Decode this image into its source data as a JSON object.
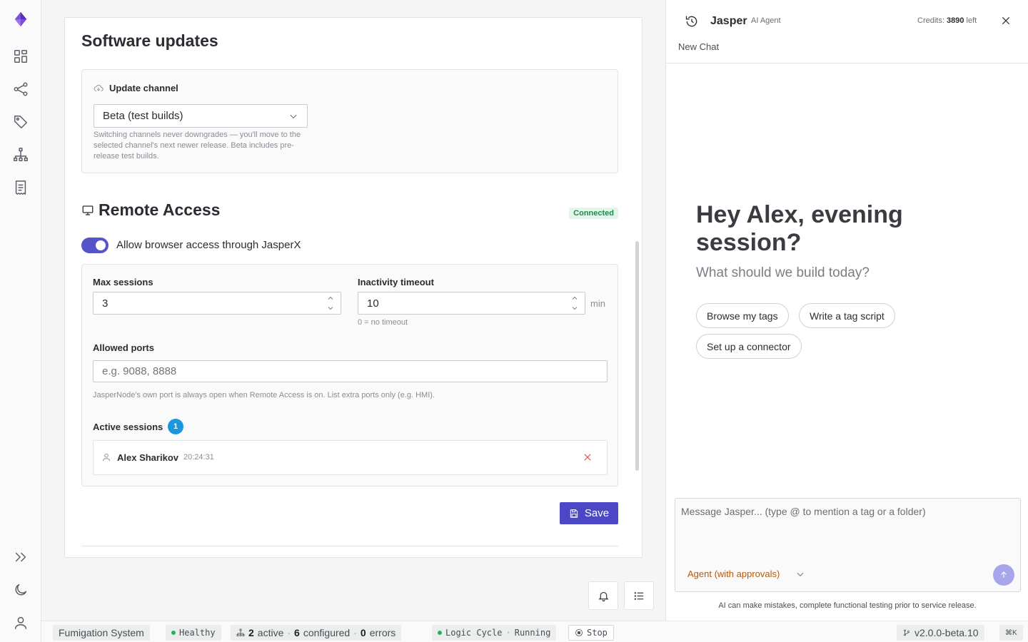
{
  "rail": {
    "items": [
      "logo-icon",
      "dashboard-icon",
      "connections-icon",
      "tags-icon",
      "hierarchy-icon",
      "receipt-icon",
      "expand-icon",
      "moon-icon",
      "user-icon"
    ]
  },
  "updates": {
    "title": "Software updates",
    "channel_label": "Update channel",
    "channel_value": "Beta (test builds)",
    "channel_help": "Switching channels never downgrades — you'll move to the selected channel's next newer release. Beta includes pre-release test builds."
  },
  "remote": {
    "title": "Remote Access",
    "status_badge": "Connected",
    "status_color": "#1f8a4c",
    "toggle_label": "Allow browser access through JasperX",
    "toggle_on": true,
    "max_sessions_label": "Max sessions",
    "max_sessions_value": "3",
    "inactivity_label": "Inactivity timeout",
    "inactivity_value": "10",
    "inactivity_unit": "min",
    "inactivity_hint": "0 = no timeout",
    "ports_label": "Allowed ports",
    "ports_placeholder": "e.g. 9088, 8888",
    "ports_hint": "JasperNode's own port is always open when Remote Access is on. List extra ports only (e.g. HMI).",
    "active_label": "Active sessions",
    "active_count": "1",
    "sessions": [
      {
        "name": "Alex Sharikov",
        "time": "20:24:31"
      }
    ],
    "save_label": "Save",
    "accent": "#4c48c5"
  },
  "status": {
    "system": "Fumigation System",
    "health": "Healthy",
    "active_count": "2",
    "active_word": "active",
    "configured_count": "6",
    "configured_word": "configured",
    "errors_count": "0",
    "errors_word": "errors",
    "logic_label": "Logic Cycle",
    "logic_state": "Running",
    "stop_label": "Stop",
    "version": "v2.0.0-beta.10",
    "shortcut": "⌘K"
  },
  "agent": {
    "name": "Jasper",
    "role": "AI Agent",
    "credits_label": "Credits:",
    "credits_value": "3890",
    "credits_suffix": "left",
    "new_chat": "New Chat",
    "greeting": "Hey Alex, evening session?",
    "subtitle": "What should we build today?",
    "suggestions": [
      "Browse my tags",
      "Write a tag script",
      "Set up a connector"
    ],
    "composer_placeholder": "Message Jasper... (type @ to mention a tag or a folder)",
    "mode": "Agent (with approvals)",
    "disclaimer": "AI can make mistakes, complete functional testing prior to service release."
  }
}
